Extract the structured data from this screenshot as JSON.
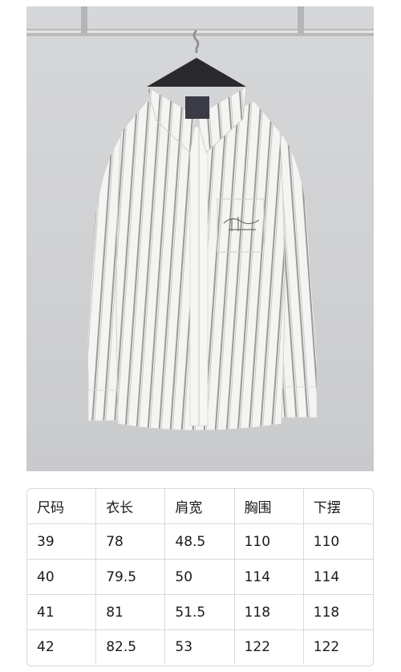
{
  "size_table": {
    "headers": [
      "尺码",
      "衣长",
      "肩宽",
      "胸围",
      "下摆"
    ],
    "rows": [
      [
        "39",
        "78",
        "48.5",
        "110",
        "110"
      ],
      [
        "40",
        "79.5",
        "50",
        "114",
        "114"
      ],
      [
        "41",
        "81",
        "51.5",
        "118",
        "118"
      ],
      [
        "42",
        "82.5",
        "53",
        "122",
        "122"
      ]
    ]
  },
  "colors": {
    "background": "#ffffff",
    "photo_wall": "#d3d4d6",
    "shirt": "#f4f4f2",
    "stripe": "#9a9b98",
    "table_border": "#d9d9d9"
  }
}
